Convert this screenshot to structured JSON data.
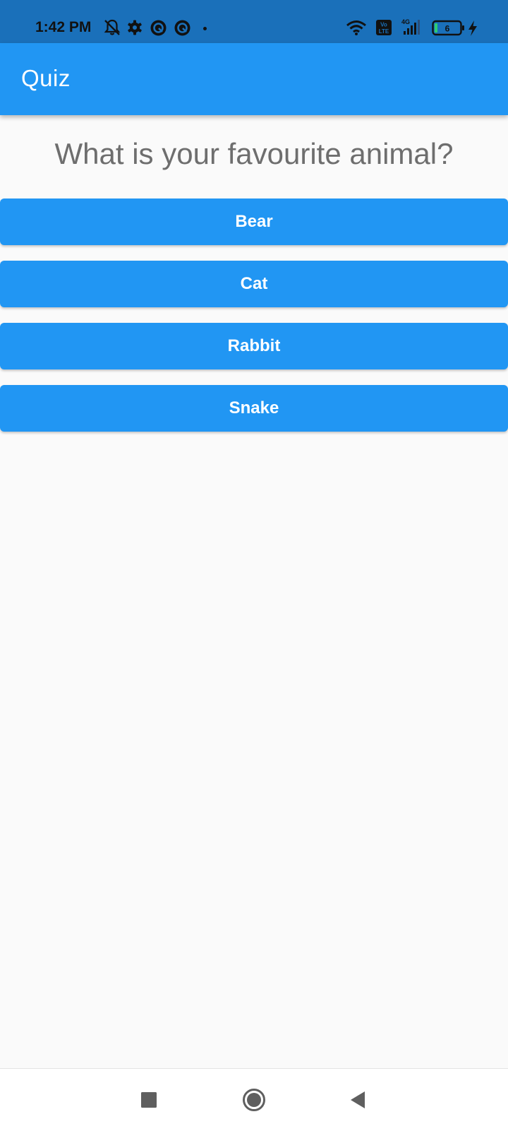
{
  "status_bar": {
    "time": "1:42 PM",
    "battery_level": "6",
    "volte_label": "Vo LTE",
    "network_label": "4G",
    "icons": [
      "notifications-off-icon",
      "settings-gear-icon",
      "app-notification-icon",
      "app-notification-icon",
      "wifi-icon",
      "volte-icon",
      "signal-icon",
      "battery-icon",
      "charging-bolt-icon"
    ],
    "background_color": "#1a70ba"
  },
  "app_bar": {
    "title": "Quiz",
    "background_color": "#2196f3"
  },
  "question": {
    "text": "What is your favourite animal?"
  },
  "answers": [
    {
      "label": "Bear"
    },
    {
      "label": "Cat"
    },
    {
      "label": "Rabbit"
    },
    {
      "label": "Snake"
    }
  ],
  "nav_bar": {
    "icons": [
      "recents-square-icon",
      "home-circle-icon",
      "back-triangle-icon"
    ]
  },
  "colors": {
    "accent": "#2196f3",
    "background": "#fafafa",
    "question_text": "#6e6e6e"
  }
}
